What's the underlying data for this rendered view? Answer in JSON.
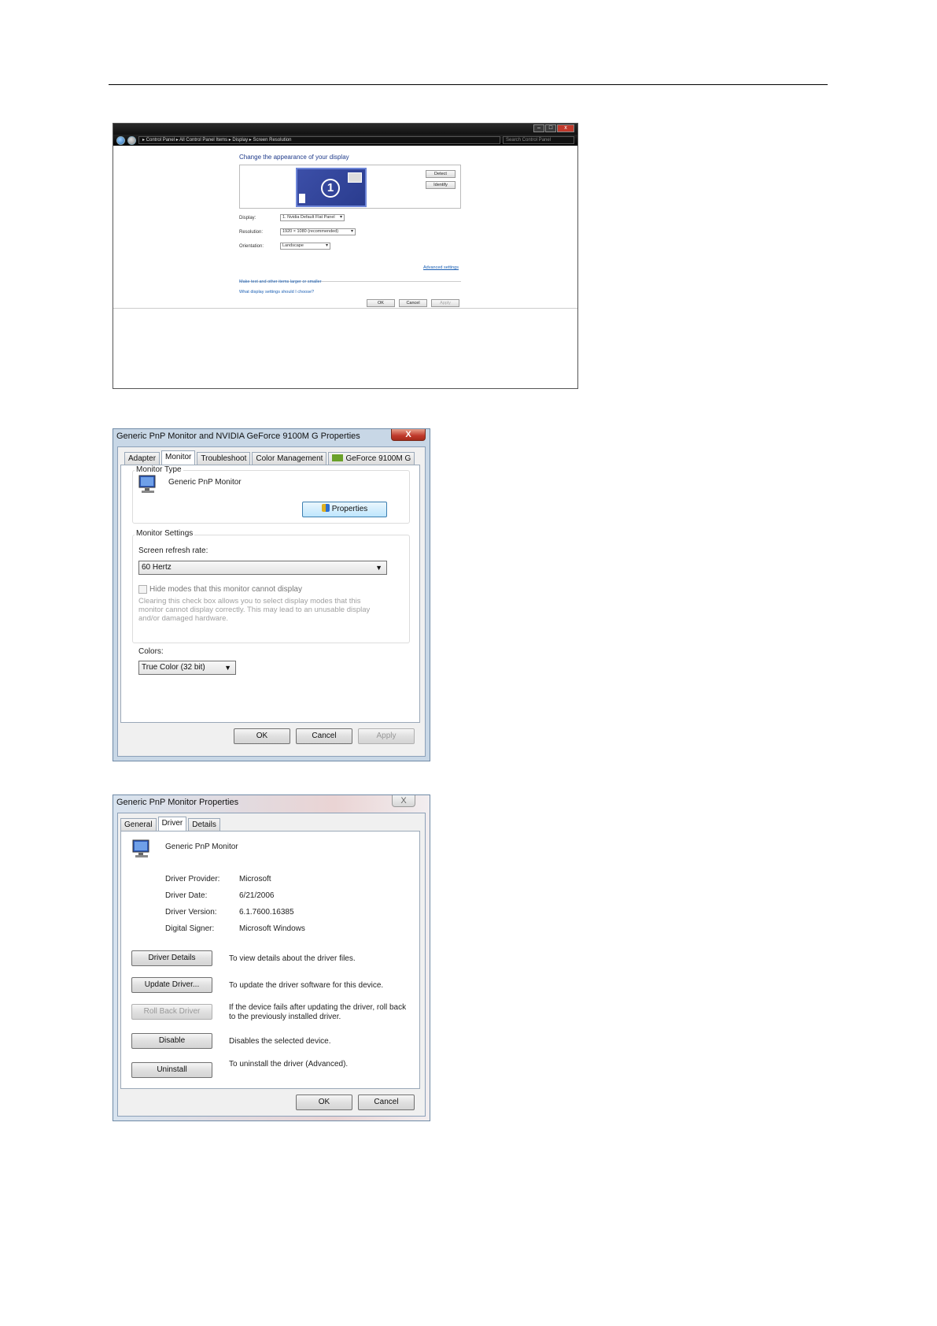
{
  "screen_resolution": {
    "caption": {
      "minimize": "–",
      "maximize": "□",
      "close": "x"
    },
    "breadcrumb": "▸ Control Panel ▸ All Control Panel Items ▸ Display ▸ Screen Resolution",
    "search_placeholder": "Search Control Panel",
    "heading": "Change the appearance of your display",
    "monitor_number": "1",
    "detect_label": "Detect",
    "identify_label": "Identify",
    "display_label": "Display:",
    "display_value": "1. Nvidia Default Flat Panel",
    "resolution_label": "Resolution:",
    "resolution_value": "1920 × 1080 (recommended)",
    "orientation_label": "Orientation:",
    "orientation_value": "Landscape",
    "advanced_link": "Advanced settings",
    "link_text_size": "Make text and other items larger or smaller",
    "link_which_settings": "What display settings should I choose?",
    "ok_label": "OK",
    "cancel_label": "Cancel",
    "apply_label": "Apply"
  },
  "monitor_properties": {
    "title": "Generic PnP Monitor and NVIDIA GeForce 9100M G   Properties",
    "close": "X",
    "tabs": [
      "Adapter",
      "Monitor",
      "Troubleshoot",
      "Color Management",
      "GeForce 9100M G"
    ],
    "active_tab": "Monitor",
    "monitor_type_label": "Monitor Type",
    "monitor_name": "Generic PnP Monitor",
    "properties_button": "Properties",
    "monitor_settings_label": "Monitor Settings",
    "refresh_rate_label": "Screen refresh rate:",
    "refresh_rate_value": "60 Hertz",
    "hide_modes_label": "Hide modes that this monitor cannot display",
    "hide_modes_help": "Clearing this check box allows you to select display modes that this monitor cannot display correctly. This may lead to an unusable display and/or damaged hardware.",
    "colors_label": "Colors:",
    "colors_value": "True Color (32 bit)",
    "ok_label": "OK",
    "cancel_label": "Cancel",
    "apply_label": "Apply"
  },
  "driver_properties": {
    "title": "Generic PnP Monitor Properties",
    "close": "X",
    "tabs": [
      "General",
      "Driver",
      "Details"
    ],
    "active_tab": "Driver",
    "device_name": "Generic PnP Monitor",
    "fields": [
      {
        "label": "Driver Provider:",
        "value": "Microsoft"
      },
      {
        "label": "Driver Date:",
        "value": "6/21/2006"
      },
      {
        "label": "Driver Version:",
        "value": "6.1.7600.16385"
      },
      {
        "label": "Digital Signer:",
        "value": "Microsoft Windows"
      }
    ],
    "actions": [
      {
        "button": "Driver Details",
        "description": "To view details about the driver files.",
        "enabled": true
      },
      {
        "button": "Update Driver...",
        "description": "To update the driver software for this device.",
        "enabled": true
      },
      {
        "button": "Roll Back Driver",
        "description": "If the device fails after updating the driver, roll back to the previously installed driver.",
        "enabled": false
      },
      {
        "button": "Disable",
        "description": "Disables the selected device.",
        "enabled": true
      },
      {
        "button": "Uninstall",
        "description": "To uninstall the driver (Advanced).",
        "enabled": true
      }
    ],
    "ok_label": "OK",
    "cancel_label": "Cancel"
  }
}
